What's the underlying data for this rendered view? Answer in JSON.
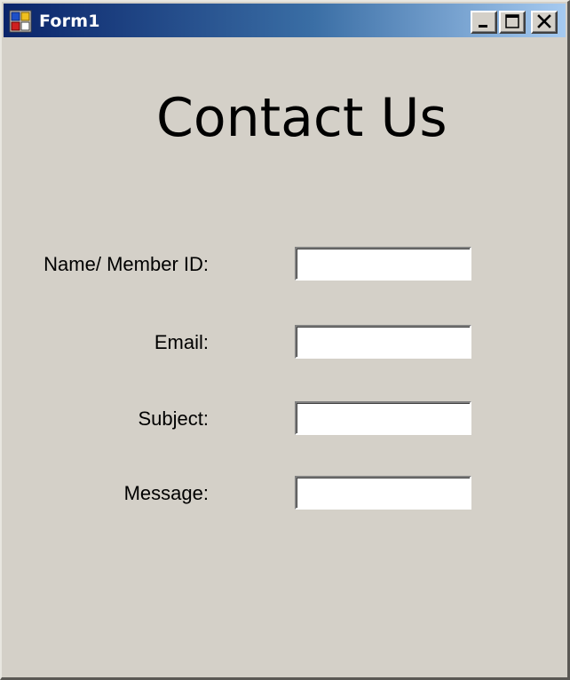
{
  "window": {
    "title": "Form1"
  },
  "caption_buttons": {
    "minimize": "minimize-icon",
    "maximize": "maximize-icon",
    "close": "close-icon"
  },
  "form": {
    "heading": "Contact Us",
    "fields": [
      {
        "label": "Name/ Member ID:",
        "value": ""
      },
      {
        "label": "Email:",
        "value": ""
      },
      {
        "label": "Subject:",
        "value": ""
      },
      {
        "label": "Message:",
        "value": ""
      }
    ]
  },
  "colors": {
    "window_background": "#d4d0c8",
    "titlebar_start": "#0a246a",
    "titlebar_end": "#a6caf0",
    "title_text": "#ffffff"
  }
}
